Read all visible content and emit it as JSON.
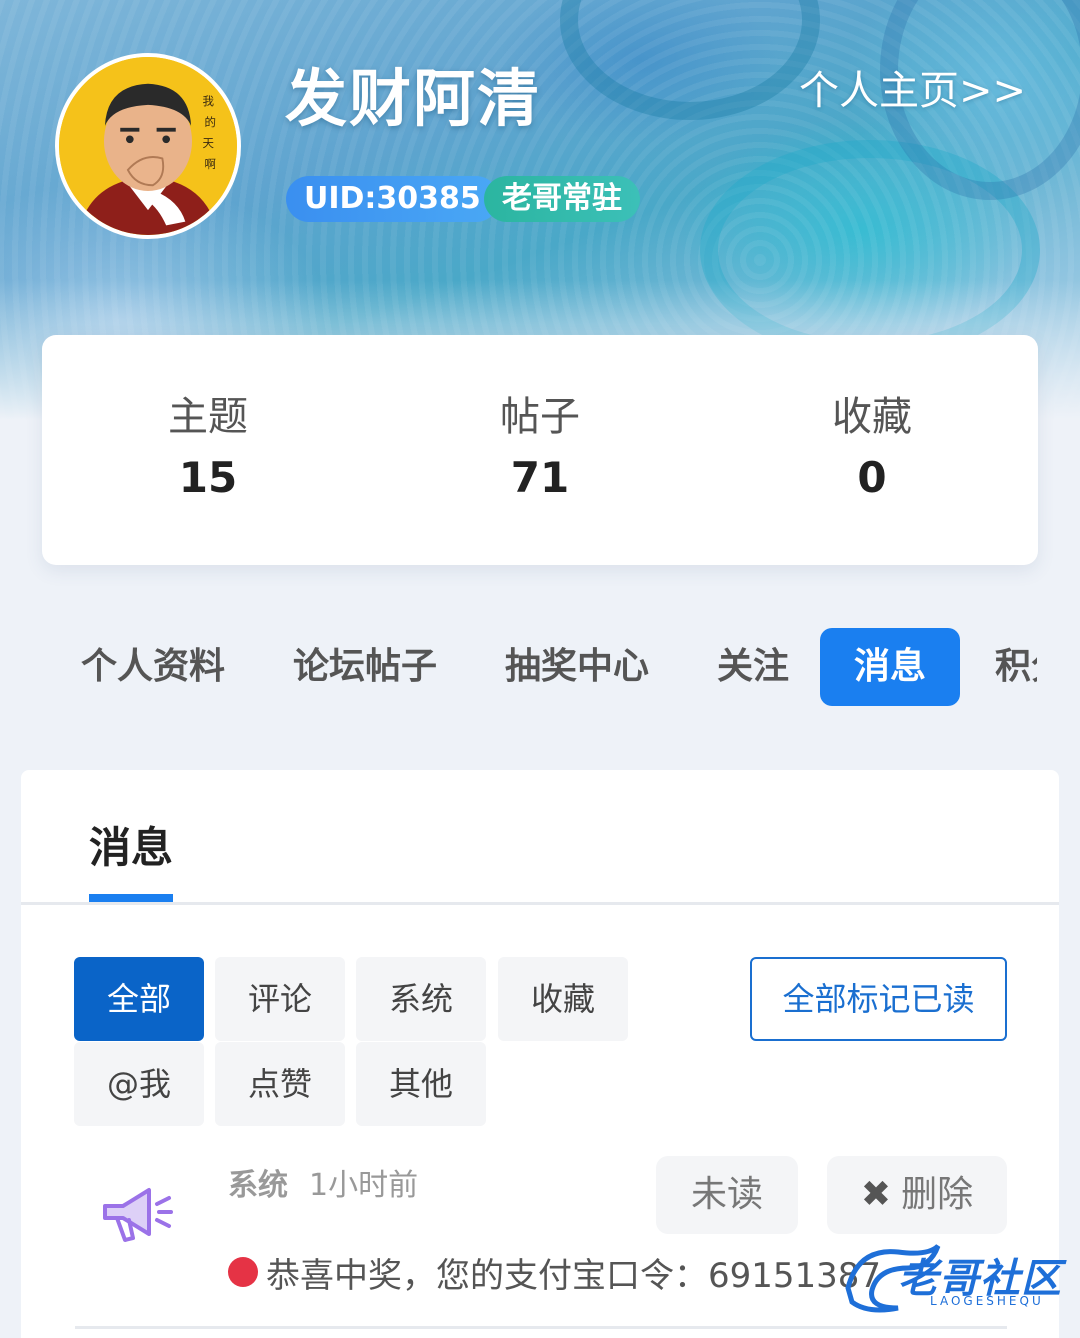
{
  "profile": {
    "username": "发财阿清",
    "home_link": "个人主页>>",
    "uid_badge": "UID:30385",
    "rank_badge": "老哥常驻",
    "avatar_caption": "我的天啊"
  },
  "stats": [
    {
      "label": "主题",
      "value": "15"
    },
    {
      "label": "帖子",
      "value": "71"
    },
    {
      "label": "收藏",
      "value": "0"
    }
  ],
  "nav": {
    "items": [
      {
        "label": "个人资料"
      },
      {
        "label": "论坛帖子"
      },
      {
        "label": "抽奖中心"
      },
      {
        "label": "关注"
      },
      {
        "label": "消息",
        "active": true
      },
      {
        "label": "积分"
      }
    ]
  },
  "panel": {
    "title": "消息",
    "filters": [
      {
        "label": "全部",
        "active": true
      },
      {
        "label": "评论"
      },
      {
        "label": "系统"
      },
      {
        "label": "收藏"
      },
      {
        "label": "@我"
      },
      {
        "label": "点赞"
      },
      {
        "label": "其他"
      }
    ],
    "mark_all_read": "全部标记已读"
  },
  "messages": [
    {
      "icon": "megaphone-icon",
      "type": "系统",
      "time": "1小时前",
      "unread_label": "未读",
      "delete_label": "删除",
      "content": "恭喜中奖，您的支付宝口令：69151387"
    }
  ],
  "watermark": {
    "text": "老哥社区",
    "subtext": "LAOGESHEQU"
  },
  "colors": {
    "accent": "#1a7ff0",
    "filter_active": "#0a64c8",
    "unread_dot": "#e53345",
    "uid_badge": "#3a8ff0",
    "rank_badge": "#2bb5a0"
  }
}
